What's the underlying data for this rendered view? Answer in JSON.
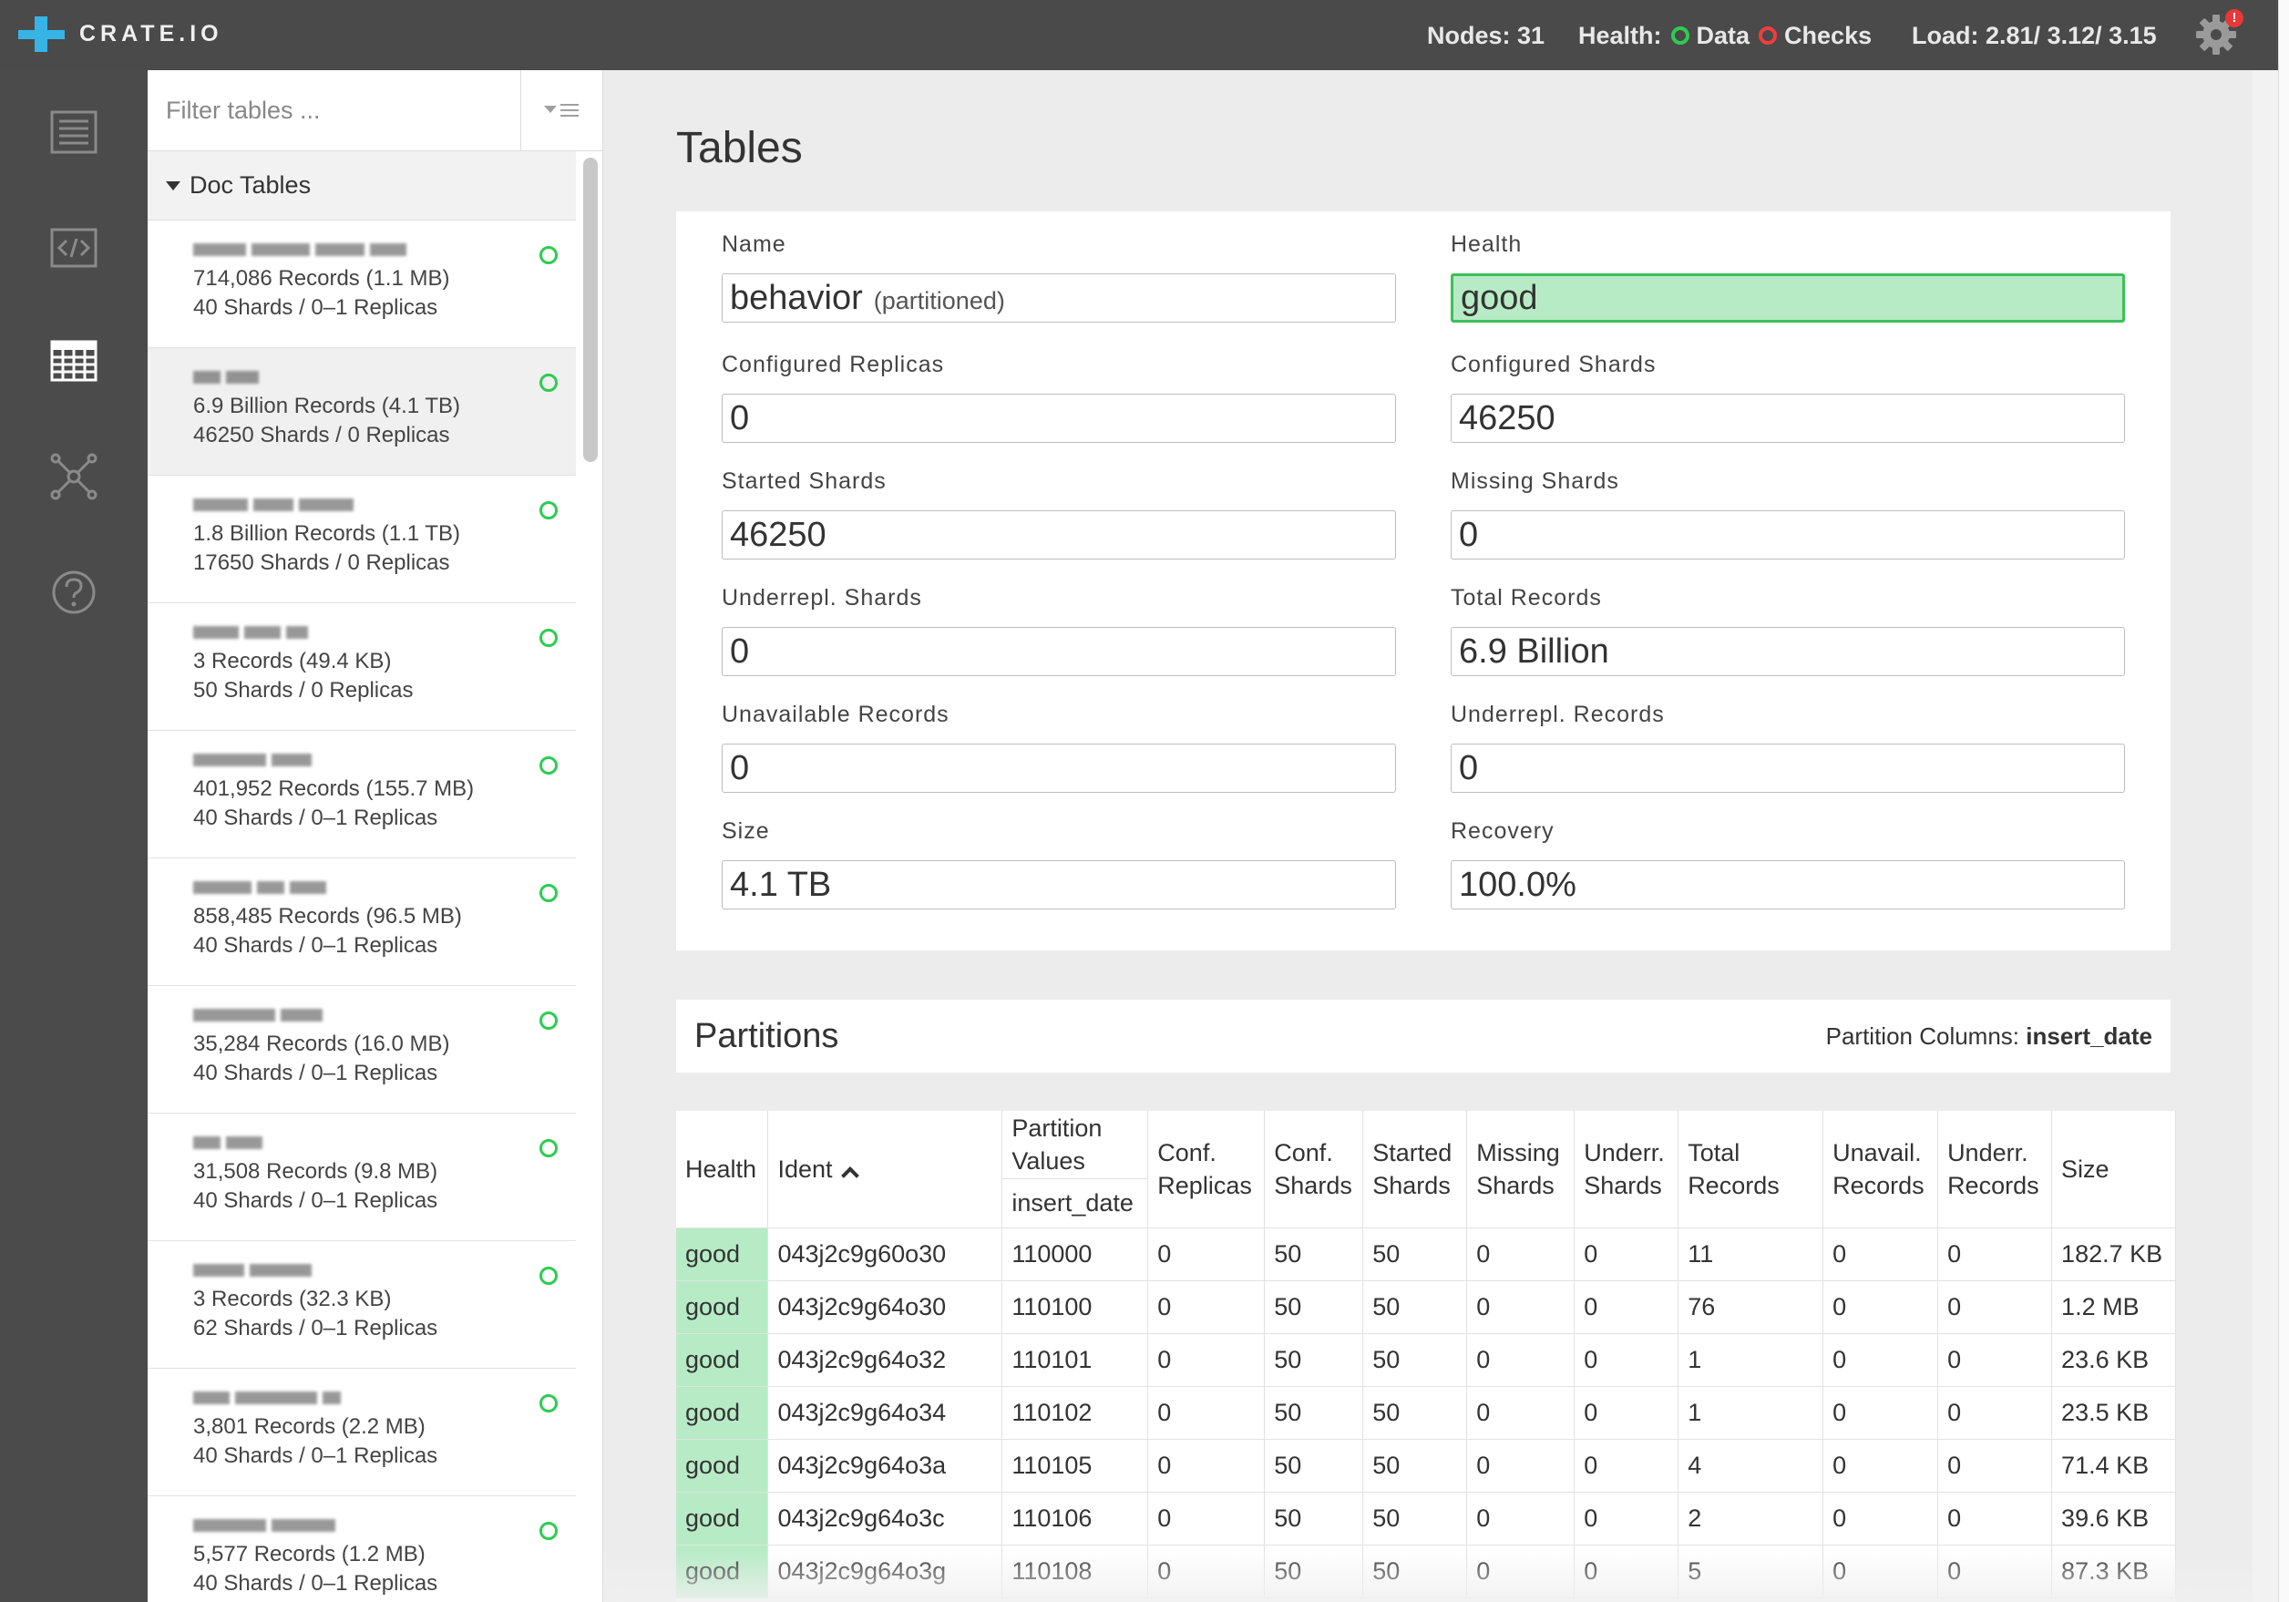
{
  "app": {
    "logo_text": "CRATE.IO"
  },
  "status": {
    "nodes_label": "Nodes:",
    "nodes_value": "31",
    "health_label": "Health:",
    "data_label": "Data",
    "checks_label": "Checks",
    "load_label": "Load:",
    "load_value": "2.81/ 3.12/ 3.15",
    "notification_badge": "!"
  },
  "nav": [
    {
      "name": "overview-icon"
    },
    {
      "name": "console-icon"
    },
    {
      "name": "tables-icon",
      "active": true
    },
    {
      "name": "cluster-icon"
    },
    {
      "name": "help-icon"
    }
  ],
  "sidebar": {
    "filter_placeholder": "Filter tables ...",
    "group_label": "Doc Tables",
    "tables": [
      {
        "line1": "714,086 Records (1.1 MB)",
        "line2": "40 Shards / 0–1 Replicas"
      },
      {
        "line1": "6.9 Billion Records (4.1 TB)",
        "line2": "46250 Shards / 0 Replicas"
      },
      {
        "line1": "1.8 Billion Records (1.1 TB)",
        "line2": "17650 Shards / 0 Replicas"
      },
      {
        "line1": "3 Records (49.4 KB)",
        "line2": "50 Shards / 0 Replicas"
      },
      {
        "line1": "401,952 Records (155.7 MB)",
        "line2": "40 Shards / 0–1 Replicas"
      },
      {
        "line1": "858,485 Records (96.5 MB)",
        "line2": "40 Shards / 0–1 Replicas"
      },
      {
        "line1": "35,284 Records (16.0 MB)",
        "line2": "40 Shards / 0–1 Replicas"
      },
      {
        "line1": "31,508 Records (9.8 MB)",
        "line2": "40 Shards / 0–1 Replicas"
      },
      {
        "line1": "3 Records (32.3 KB)",
        "line2": "62 Shards / 0–1 Replicas"
      },
      {
        "line1": "3,801 Records (2.2 MB)",
        "line2": "40 Shards / 0–1 Replicas"
      },
      {
        "line1": "5,577 Records (1.2 MB)",
        "line2": "40 Shards / 0–1 Replicas"
      }
    ]
  },
  "main": {
    "title": "Tables",
    "info": {
      "name_label": "Name",
      "name_value": "behavior",
      "name_suffix": "(partitioned)",
      "health_label": "Health",
      "health_value": "good",
      "configured_replicas_label": "Configured Replicas",
      "configured_replicas_value": "0",
      "configured_shards_label": "Configured Shards",
      "configured_shards_value": "46250",
      "started_shards_label": "Started Shards",
      "started_shards_value": "46250",
      "missing_shards_label": "Missing Shards",
      "missing_shards_value": "0",
      "underrepl_shards_label": "Underrepl. Shards",
      "underrepl_shards_value": "0",
      "total_records_label": "Total Records",
      "total_records_value": "6.9 Billion",
      "unavailable_records_label": "Unavailable Records",
      "unavailable_records_value": "0",
      "underrepl_records_label": "Underrepl. Records",
      "underrepl_records_value": "0",
      "size_label": "Size",
      "size_value": "4.1 TB",
      "recovery_label": "Recovery",
      "recovery_value": "100.0%"
    },
    "partitions": {
      "title": "Partitions",
      "columns_label": "Partition Columns:",
      "columns_value": "insert_date",
      "headers": {
        "health": "Health",
        "ident": "Ident",
        "partition_values": "Partition Values",
        "partition_col": "insert_date",
        "conf_replicas": "Conf. Replicas",
        "conf_shards": "Conf. Shards",
        "started_shards": "Started Shards",
        "missing_shards": "Missing Shards",
        "underr_shards": "Underr. Shards",
        "total_records": "Total Records",
        "unavail_records": "Unavail. Records",
        "underr_records": "Underr. Records",
        "size": "Size"
      },
      "rows": [
        [
          "good",
          "043j2c9g60o30",
          "110000",
          "0",
          "50",
          "50",
          "0",
          "0",
          "11",
          "0",
          "0",
          "182.7 KB"
        ],
        [
          "good",
          "043j2c9g64o30",
          "110100",
          "0",
          "50",
          "50",
          "0",
          "0",
          "76",
          "0",
          "0",
          "1.2 MB"
        ],
        [
          "good",
          "043j2c9g64o32",
          "110101",
          "0",
          "50",
          "50",
          "0",
          "0",
          "1",
          "0",
          "0",
          "23.6 KB"
        ],
        [
          "good",
          "043j2c9g64o34",
          "110102",
          "0",
          "50",
          "50",
          "0",
          "0",
          "1",
          "0",
          "0",
          "23.5 KB"
        ],
        [
          "good",
          "043j2c9g64o3a",
          "110105",
          "0",
          "50",
          "50",
          "0",
          "0",
          "4",
          "0",
          "0",
          "71.4 KB"
        ],
        [
          "good",
          "043j2c9g64o3c",
          "110106",
          "0",
          "50",
          "50",
          "0",
          "0",
          "2",
          "0",
          "0",
          "39.6 KB"
        ],
        [
          "good",
          "043j2c9g64o3g",
          "110108",
          "0",
          "50",
          "50",
          "0",
          "0",
          "5",
          "0",
          "0",
          "87.3 KB"
        ]
      ]
    }
  },
  "colors": {
    "topbar": "#4a4a4a",
    "rail": "#4b4b4b",
    "accent": "#36b4e6",
    "good": "#b7ebc5",
    "status_green": "#2ecc52",
    "status_red": "#ef3d3d"
  }
}
